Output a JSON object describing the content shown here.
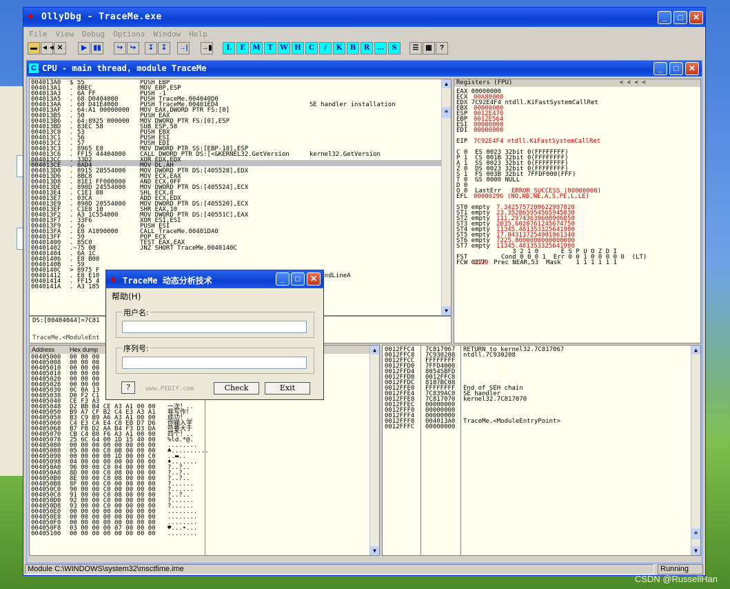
{
  "window": {
    "title": "OllyDbg - TraceMe.exe"
  },
  "menu": [
    "File",
    "View",
    "Debug",
    "Options",
    "Window",
    "Help"
  ],
  "toolbar": {
    "nav": [
      "◄◄",
      "✕",
      "▶",
      "▮▮",
      "↪",
      "↪",
      "↧",
      "↧",
      "→|",
      "→▮"
    ],
    "letters": [
      "L",
      "E",
      "M",
      "T",
      "W",
      "H",
      "C",
      "/",
      "K",
      "B",
      "R",
      "...",
      "S"
    ],
    "tail": [
      "☰",
      "▦",
      "?"
    ]
  },
  "cpu": {
    "title": "CPU - main thread, module TraceMe",
    "disasm": {
      "addresses": "004013A0\n004013A1\n004013A3\n004013A5\n004013AA\n004013AF\n004013B5\n004013B6\n004013BD\n004013C0\n004013C1\n004013C2\n004013C3\n004013C6\n004013CC\n004013CE\n004013D0\n004013D6\n004013D8\n004013DE\n004013E4\n004013E7\n004013E9\n004013EF\n004013F2\n004013F7\n004013F9\n004013FA\n004013FF\n00401400\n00401402\n00401404\n00401406\n0040140B\n0040140C\n00401412\n00401414\n0040141A",
      "hex": "$ 55\n. 8BEC\n. 6A FF\n. 68 D0404000\n. 68 D41E4000\n. 64:A1 00000000\n. 50\n. 64:8925 000000\n. 83EC 58\n. 53\n. 56\n. 57\n. 8965 E8\n. FF15 44404000\n. 33D2\n. 8AD4\n. 8915 28554000\n. 8BC8\n. 81E1 FF000000\n. 890D 24554000\n. C1E1 08\n. 03CA\n. 890D 20554000\n. C1E8 10\n. A3 1C554000\n. 33F6\n. 56\n. E8 A1090000\n. 59\n. 85C0\n.~75 08\n. 6A 1C\n. E8 B00\n. 59\n> 8975 F\n. E8 E10\n. FF15 4\n. A3 185",
      "code": "PUSH EBP\nMOV EBP,ESP\nPUSH -1\nPUSH TraceMe.004040D0\nPUSH TraceMe.00401ED4\nMOV EAX,DWORD PTR FS:[0]\nPUSH EAX\nMOV DWORD PTR FS:[0],ESP\nSUB ESP,58\nPUSH EBX\nPUSH ESI\nPUSH EDI\nMOV DWORD PTR SS:[EBP-18],ESP\nCALL DWORD PTR DS:[<&KERNEL32.GetVersion\nXOR EDX,EDX\nMOV DL,AH\nMOV DWORD PTR DS:[405528],EDX\nMOV ECX,EAX\nAND ECX,0FF\nMOV DWORD PTR DS:[405524],ECX\nSHL ECX,8\nADD ECX,EDX\nMOV DWORD PTR DS:[405520],ECX\nSHR EAX,10\nMOV DWORD PTR DS:[40551C],EAX\nXOR ESI,ESI\nPUSH ESI\nCALL TraceMe.00401DA0\nPOP ECX\nTEST EAX,EAX\nJNZ SHORT TraceMe.0040140C",
      "comments": "\n\n\n\nSE handler installation\n\n\n\n\n\n\n\n\nkernel32.GetVersion\n\n\n\n\n\n\n\n\n\n\n\n\n\n\n\n\n\n\n\n\n\nommandLineA"
    },
    "info": {
      "line1": "DS:[00404044]=7C81",
      "line2": "TraceMe.<ModuleEnt"
    },
    "registers": {
      "header": "Registers (FPU)",
      "header_arrows": "<     <     <     <",
      "text_black": "EAX 00000000\nECX\nEDX 7C92E4F4 ntdll.KiFastSystemCallRet\nEBX\nESP\nEBP\nESI\nEDI\n\nEIP\n\nC 0  ES 0023 32bit 0(FFFFFFFF)\nP 1  CS 001B 32bit 0(FFFFFFFF)\nA 1  SS 0023 32bit 0(FFFFFFFF)\nZ 0  DS 0023 32bit 0(FFFFFFFF)\nS 1  FS 003B 32bit 7FFDF000(FFF)\nT 0  GS 0000 NULL\nD 0\nO 0  LastErr\nEFL\n\nST0 empty\nST1 empty\nST2 empty\nST3 empty\nST4 empty\nST5 empty\nST6 empty\nST7 empty\n               3 2 1 0      E S P U O Z D I\nFST         Cond 0 0 0 1  Err 0 0 1 0 0 0 0 0  (LT)\nFCW 027F  Prec NEAR,53  Mask    1 1 1 1 1 1",
      "ecx": "00A80000",
      "ebx": "00000000",
      "esp": "0012E470",
      "ebp": "0012E564",
      "esi": "00000000",
      "edi": "00000000",
      "eip": "7C92E4F4 ntdll.KiFastSystemCallRet",
      "lasterr": "ERROR_SUCCESS (00000000)",
      "efl": "00000296 (NO,NB,NE,A,S,PE,L,LE)",
      "st_values": "7.3425757209622997820\n23.352865954565945830\n111.29743639608906850\n2035.6020761245674750\n11345.481353325641980\n17.843137254901961340\n7225.0000000000000000\n11345.481353325641980",
      "fpu_flags": "0120"
    },
    "dump": {
      "col_address": "Address",
      "col_hex": "Hex dump",
      "addresses": "00405000\n00405008\n00405010\n00405018\n00405020\n00405028\n00405030\n00405038\n00405040\n00405048\n00405050\n00405058\n00405060\n00405068\n00405070\n00405078\n00405080\n00405088\n00405090\n00405098\n004050A0\n004050A8\n004050B0\n004050B8\n004050C0\n004050C8\n004050D0\n004050D8\n004050E0\n004050E8\n004050F0\n004050F8\n00405100",
      "hex": "00 00 00\n00 00 00\n00 00 00\n00 00 00\n00 00 00\n00 00 00\n0C 0A 13\nD0 F2 C1\nCE F3 A3\nD2 BB B4 CE A3 A1 00 00\nB9 A7 CF B2 C4 E3 A3 A1\nB3 C9 B9 A6 A3 A1 00 00\nC4 E3 CA E4 C8 EB D7 D6\nB7 FB D2 AA B4 F3 D3 DA\nCB C4 B8 F6 A3 A1 00 00\n25 6C 64 00 1D 15 40 00\n00 00 00 00 00 00 00 00\n05 00 00 C0 0B 00 00 00\n00 00 00 00 1D 00 00 C0\n04 00 00 00 00 00 00 00\n96 00 00 C0 04 00 00 00\n8D 00 00 C0 08 00 00 00\n8E 00 00 C0 08 00 00 00\n8F 00 00 C0 00 00 00 00\n90 00 00 C0 00 00 00 00\n91 00 00 C0 08 00 00 00\n92 00 00 C0 00 00 00 00\n93 00 00 C0 00 00 00 00\n00 00 00 00 00 00 00 00\n00 00 00 00 00 00 00 00\n00 00 00 00 00 00 00 00\n03 00 00 00 07 00 00 00\n00 00 00 00 00 00 00 00",
      "ascii": "\n\n\n\n\n\n\n\n\n一次！..\n菲写作！\n成功！..\n你输入字\n符要大于\n四个！..\n%ld.*@.\n........\n♣..........\n..▬..\n♦.......\n?..?..\n?..?..\n?..?..\n?......\n?......\n?..?..\n?......\n?......\n........\n........\n........\n♥...•...\n........"
    },
    "stack": {
      "addresses": "0012FFC4\n0012FFC8\n0012FFCC\n0012FFD0\n0012FFD4\n0012FFD8\n0012FFDC\n0012FFE0\n0012FFE4\n0012FFE8\n0012FFEC\n0012FFF0\n0012FFF4\n0012FFF8\n0012FFFC",
      "values": "7C817067\n7C930208\nFFFFFFFF\n7FFD4000\n8054SBFD\n0012FFC8\n8187BC08\nFFFFFFFF\n7C839AC0\n7C817070\n00000000\n00000000\n00000000\n004013A0\n00000000",
      "comments": "RETURN to kernel32.7C817067\nntdll.7C930208\n\n\n\n\n\nEnd of SEH chain\nSE handler\nkernel32.7C817070\n\n\n\nTraceMe.<ModuleEntryPoint>\n"
    }
  },
  "status": {
    "message": "Module C:\\WINDOWS\\system32\\msctfime.ime",
    "state": "Running"
  },
  "dialog": {
    "title": "TraceMe 动态分析技术",
    "menu": "帮助(H)",
    "username_label": "用户名:",
    "serial_label": "序列号:",
    "help_button": "?",
    "website": "www.PEDIY.com",
    "check_button": "Check",
    "exit_button": "Exit"
  },
  "watermark": "CSDN @RussellHan"
}
